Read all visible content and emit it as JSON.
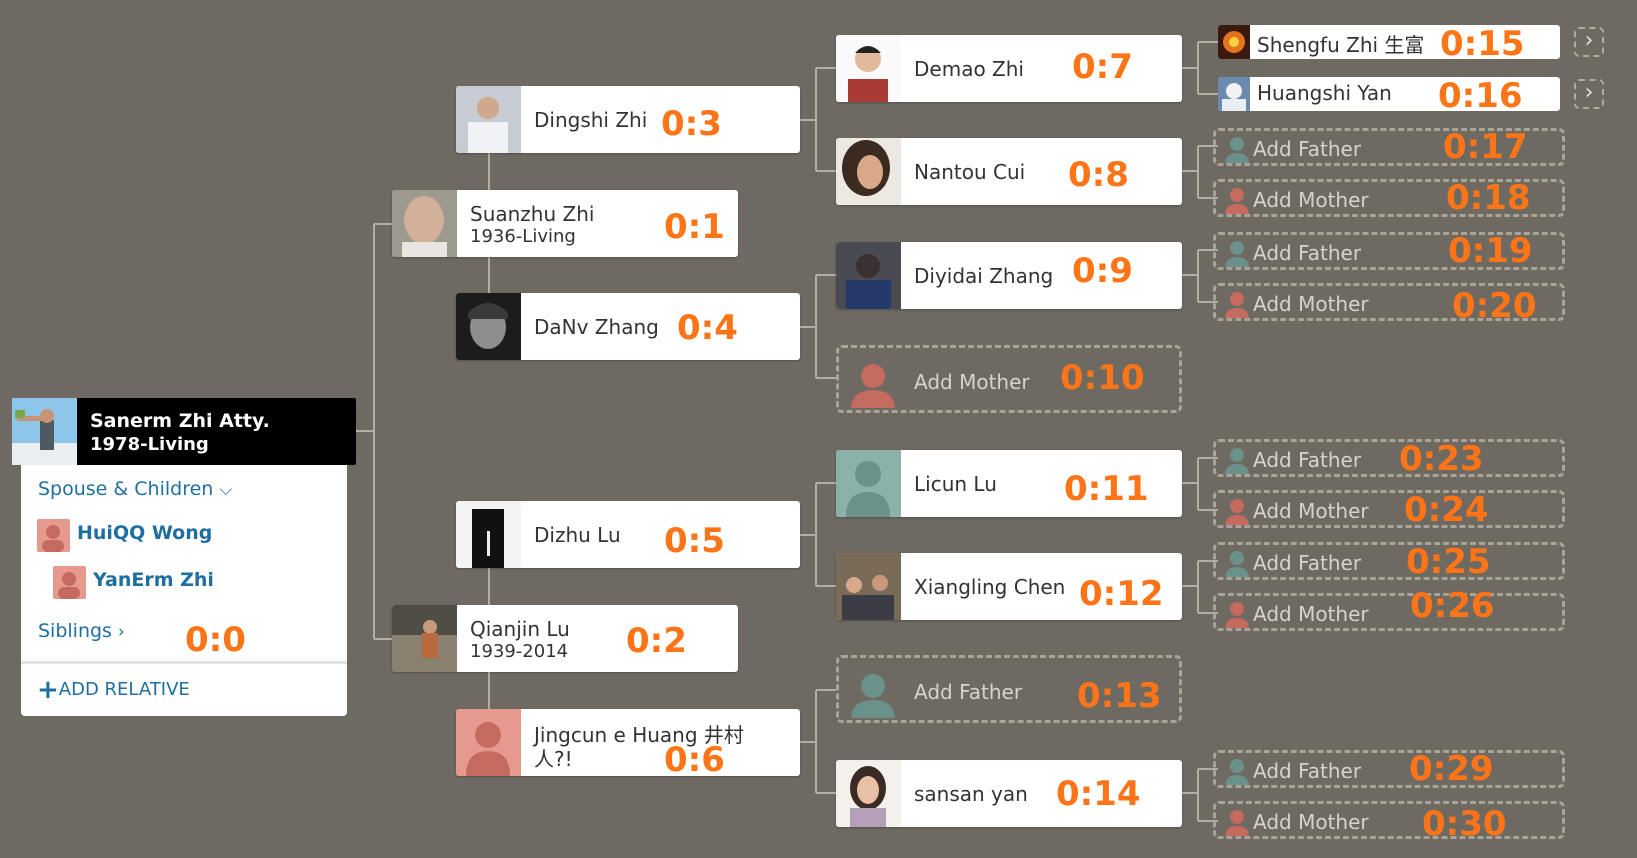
{
  "root": {
    "name": "Sanerm Zhi Atty.",
    "years": "1978-Living",
    "spouse_label": "Spouse & Children",
    "spouse": "HuiQQ Wong",
    "child": "YanErm Zhi",
    "siblings_label": "Siblings",
    "add_relative_label": "ADD RELATIVE"
  },
  "people": {
    "p1": {
      "name": "Suanzhu Zhi",
      "years": "1936-Living"
    },
    "p2": {
      "name": "Qianjin Lu",
      "years": "1939-2014"
    },
    "p3": {
      "name": "Dingshi Zhi"
    },
    "p4": {
      "name": "DaNv Zhang"
    },
    "p5": {
      "name": "Dizhu Lu"
    },
    "p6": {
      "name": "Jingcun e Huang 井村",
      "name2": "人?!"
    },
    "p7": {
      "name": "Demao Zhi"
    },
    "p8": {
      "name": "Nantou Cui"
    },
    "p9": {
      "name": "Diyidai Zhang"
    },
    "p11": {
      "name": "Licun Lu"
    },
    "p12": {
      "name": "Xiangling Chen"
    },
    "p14": {
      "name": "sansan yan"
    },
    "p15": {
      "name": "Shengfu Zhi 生富"
    },
    "p16": {
      "name": "Huangshi Yan"
    }
  },
  "add_labels": {
    "father": "Add Father",
    "mother": "Add Mother"
  },
  "tags": {
    "t0": "0:0",
    "t1": "0:1",
    "t2": "0:2",
    "t3": "0:3",
    "t4": "0:4",
    "t5": "0:5",
    "t6": "0:6",
    "t7": "0:7",
    "t8": "0:8",
    "t9": "0:9",
    "t10": "0:10",
    "t11": "0:11",
    "t12": "0:12",
    "t13": "0:13",
    "t14": "0:14",
    "t15": "0:15",
    "t16": "0:16",
    "t17": "0:17",
    "t18": "0:18",
    "t19": "0:19",
    "t20": "0:20",
    "t23": "0:23",
    "t24": "0:24",
    "t25": "0:25",
    "t26": "0:26",
    "t29": "0:29",
    "t30": "0:30"
  },
  "colors": {
    "background": "#6e6a62",
    "tag": "#ff7417",
    "link": "#1e6fa0",
    "female_avatar": "#e69a8f",
    "male_avatar": "#8ab1aa"
  },
  "icons": {
    "expand": "chevron-right-icon",
    "add": "plus-icon"
  }
}
